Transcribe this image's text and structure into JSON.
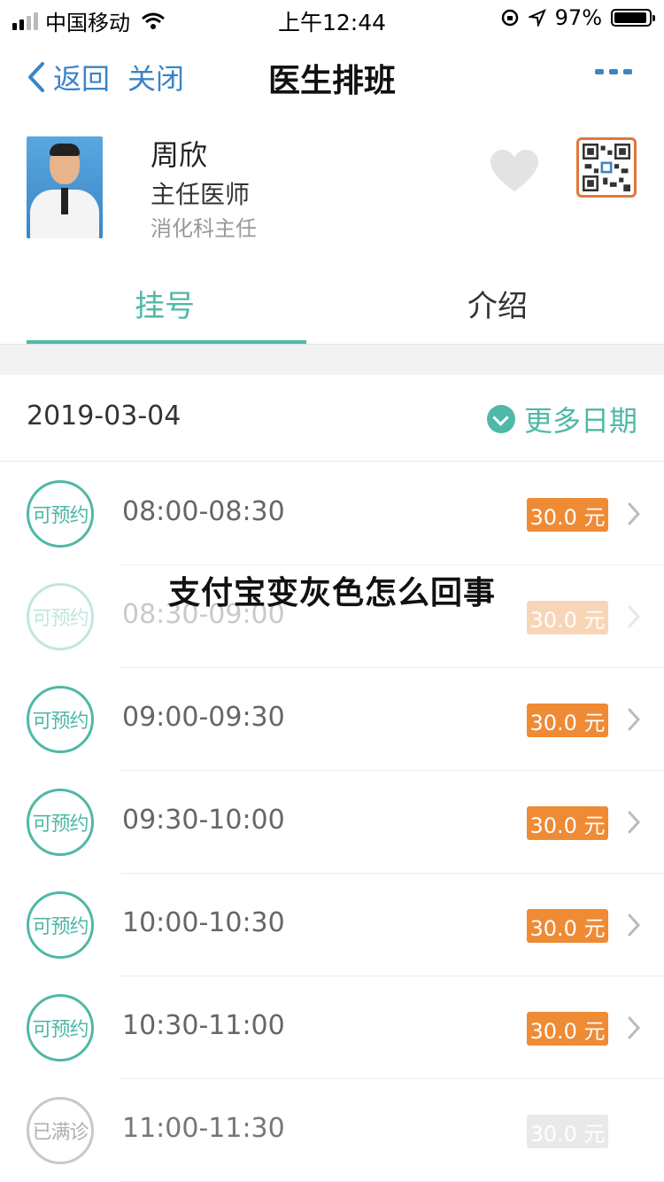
{
  "status_bar": {
    "carrier": "中国移动",
    "time": "上午12:44",
    "battery": "97%"
  },
  "nav": {
    "back_label": "返回",
    "close_label": "关闭",
    "title": "医生排班"
  },
  "doctor": {
    "name": "周欣",
    "title": "主任医师",
    "department": "消化科主任"
  },
  "tabs": [
    {
      "label": "挂号",
      "active": true
    },
    {
      "label": "介绍",
      "active": false
    }
  ],
  "schedule": {
    "date": "2019-03-04",
    "more_dates_label": "更多日期",
    "slots": [
      {
        "status": "可预约",
        "time": "08:00-08:30",
        "price": "30.0 元"
      },
      {
        "status": "可预约",
        "time": "08:30-09:00",
        "price": "30.0 元"
      },
      {
        "status": "可预约",
        "time": "09:00-09:30",
        "price": "30.0 元"
      },
      {
        "status": "可预约",
        "time": "09:30-10:00",
        "price": "30.0 元"
      },
      {
        "status": "可预约",
        "time": "10:00-10:30",
        "price": "30.0 元"
      },
      {
        "status": "可预约",
        "time": "10:30-11:00",
        "price": "30.0 元"
      },
      {
        "status": "已满诊",
        "time": "11:00-11:30",
        "price": "30.0 元"
      }
    ]
  },
  "overlay_text": "支付宝变灰色怎么回事",
  "colors": {
    "accent": "#4fb8a6",
    "link": "#3a85c6",
    "price": "#ef8a35"
  }
}
